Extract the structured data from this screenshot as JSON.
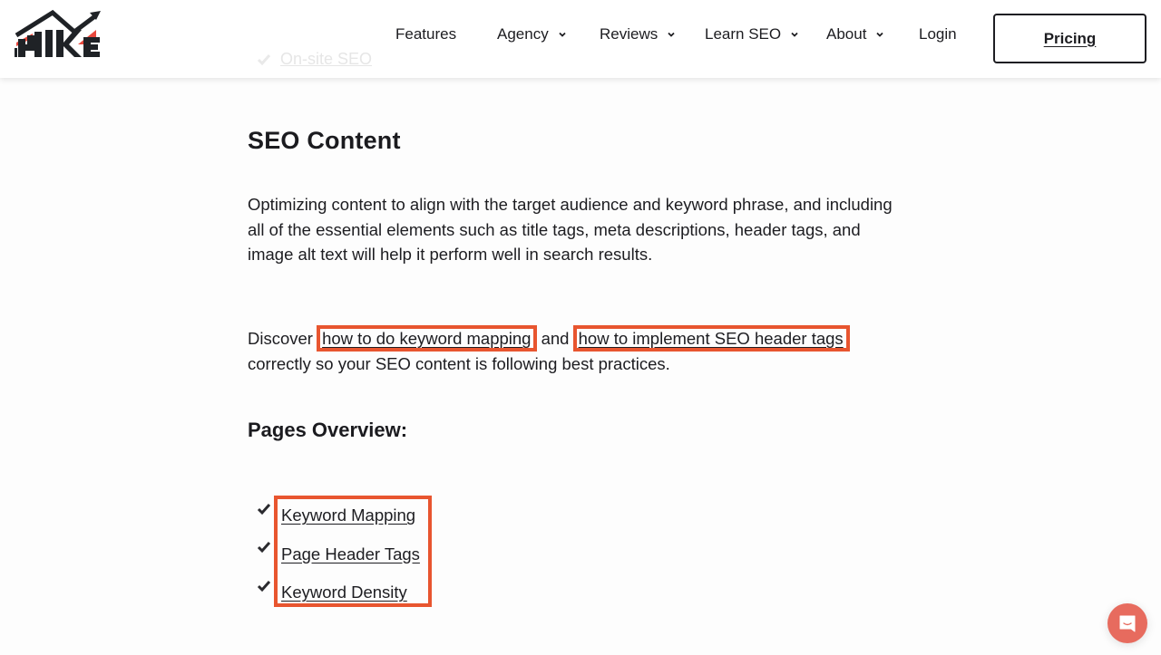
{
  "header": {
    "logo_text": "HIKE",
    "nav": [
      {
        "label": "Features",
        "has_dropdown": false
      },
      {
        "label": "Agency",
        "has_dropdown": true
      },
      {
        "label": "Reviews",
        "has_dropdown": true
      },
      {
        "label": "Learn SEO",
        "has_dropdown": true
      },
      {
        "label": "About",
        "has_dropdown": true
      },
      {
        "label": "Login",
        "has_dropdown": false
      }
    ],
    "pricing_label": "Pricing"
  },
  "faded_list_item": {
    "label": "On-site SEO"
  },
  "main": {
    "section_title": "SEO Content",
    "paragraph_1": "Optimizing content to align with the target audience and keyword phrase, and including all of the essential elements such as title tags, meta descriptions, header tags, and image alt text will help it perform well in search results.",
    "paragraph_2": {
      "prefix": "Discover ",
      "link_1": "how to do keyword mapping",
      "middle": " and ",
      "link_2": "how to implement SEO header tags",
      "suffix": " correctly so your SEO content is following best practices."
    },
    "pages_overview_title": "Pages Overview:",
    "pages": [
      {
        "label": "Keyword Mapping"
      },
      {
        "label": "Page Header Tags"
      },
      {
        "label": "Keyword Density"
      }
    ]
  },
  "colors": {
    "highlight_border": "#e8552f",
    "logo_red": "#e8483d",
    "logo_dark": "#1f2226",
    "chat_button": "#e76b5e",
    "text": "#1d1d21"
  },
  "chat": {
    "icon": "chat-bubble-icon"
  }
}
